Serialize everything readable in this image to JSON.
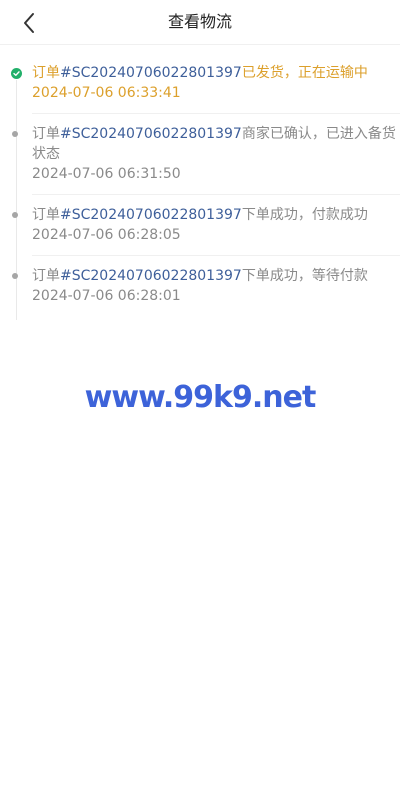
{
  "header": {
    "title": "查看物流",
    "back_icon": "chevron-left-icon"
  },
  "timeline": [
    {
      "prefix": "订单",
      "order_no": "#SC20240706022801397",
      "status": "已发货，正在运输中",
      "time": "2024-07-06 06:33:41",
      "active": true
    },
    {
      "prefix": "订单",
      "order_no": "#SC20240706022801397",
      "status": "商家已确认，已进入备货状态",
      "time": "2024-07-06 06:31:50",
      "active": false
    },
    {
      "prefix": "订单",
      "order_no": "#SC20240706022801397",
      "status": "下单成功，付款成功",
      "time": "2024-07-06 06:28:05",
      "active": false
    },
    {
      "prefix": "订单",
      "order_no": "#SC20240706022801397",
      "status": "下单成功，等待付款",
      "time": "2024-07-06 06:28:01",
      "active": false
    }
  ],
  "watermark": "www.99k9.net",
  "colors": {
    "active": "#dca02c",
    "order_no": "#3e5f9a",
    "muted": "#8a8a8a",
    "active_dot": "#22b06a",
    "watermark": "#3d63d9"
  }
}
